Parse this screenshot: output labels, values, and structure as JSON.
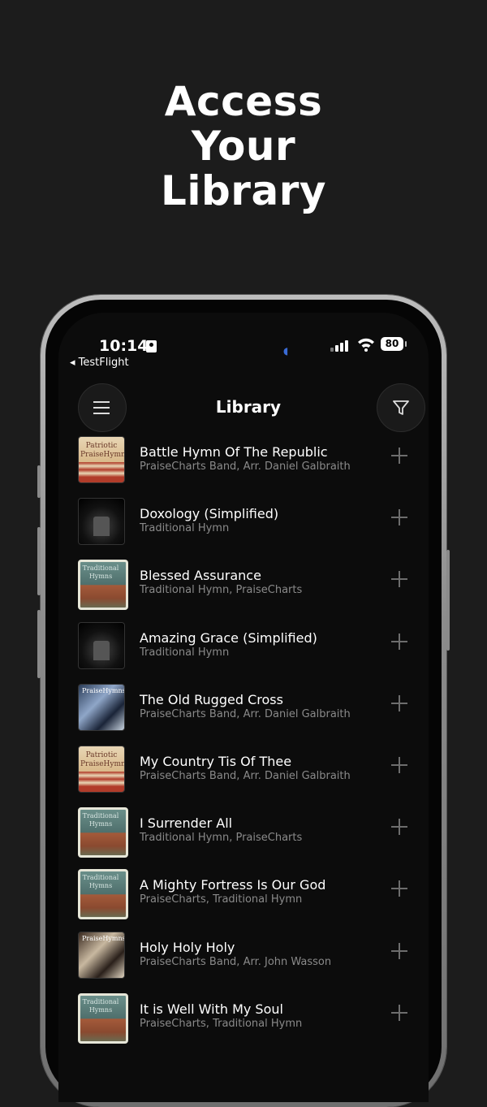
{
  "headline": [
    "Access",
    "Your",
    "Library"
  ],
  "status_bar": {
    "time": "10:14",
    "back_app": "◂ TestFlight",
    "battery": "80"
  },
  "nav": {
    "title": "Library"
  },
  "songs": [
    {
      "title": "Battle Hymn Of The Republic",
      "subtitle": "PraiseCharts Band, Arr. Daniel Galbraith",
      "art": "patriotic"
    },
    {
      "title": "Doxology (Simplified)",
      "subtitle": "Traditional Hymn",
      "art": "dark"
    },
    {
      "title": "Blessed Assurance",
      "subtitle": "Traditional Hymn, PraiseCharts",
      "art": "traditional"
    },
    {
      "title": "Amazing Grace (Simplified)",
      "subtitle": "Traditional Hymn",
      "art": "dark"
    },
    {
      "title": "The Old Rugged Cross",
      "subtitle": "PraiseCharts Band, Arr. Daniel Galbraith",
      "art": "ph"
    },
    {
      "title": "My Country Tis Of Thee",
      "subtitle": "PraiseCharts Band, Arr. Daniel Galbraith",
      "art": "patriotic"
    },
    {
      "title": "I Surrender All",
      "subtitle": "Traditional Hymn, PraiseCharts",
      "art": "traditional"
    },
    {
      "title": "A Mighty Fortress Is Our God",
      "subtitle": "PraiseCharts, Traditional Hymn",
      "art": "traditional"
    },
    {
      "title": "Holy Holy Holy",
      "subtitle": "PraiseCharts Band, Arr. John Wasson",
      "art": "ph2"
    },
    {
      "title": "It is Well With My Soul",
      "subtitle": "PraiseCharts, Traditional Hymn",
      "art": "traditional"
    }
  ]
}
